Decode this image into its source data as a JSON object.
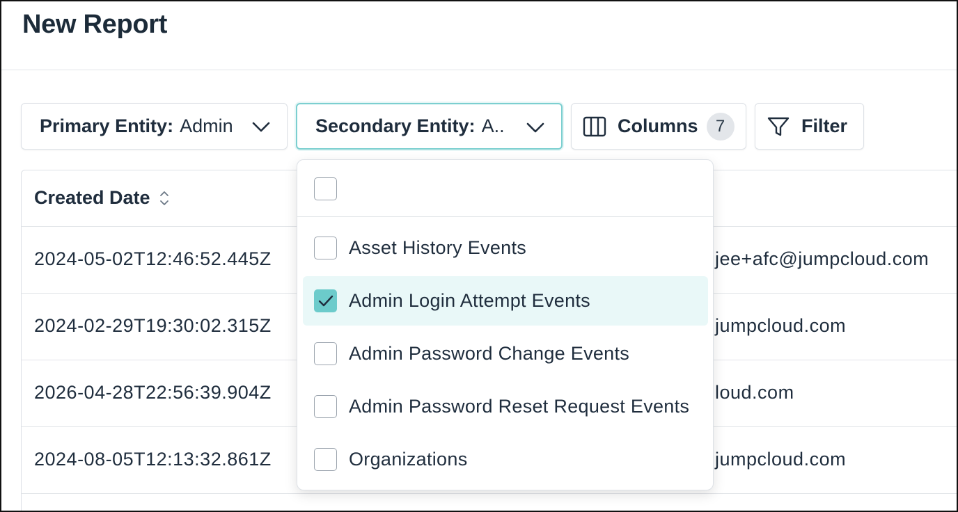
{
  "header": {
    "title": "New Report"
  },
  "toolbar": {
    "primary": {
      "label": "Primary Entity:",
      "value": "Admin"
    },
    "secondary": {
      "label": "Secondary Entity:",
      "value": "A.."
    },
    "columns": {
      "label": "Columns",
      "count": "7"
    },
    "filter": {
      "label": "Filter"
    }
  },
  "table": {
    "header": "Created Date",
    "rows": [
      {
        "date": "2024-05-02T12:46:52.445Z",
        "email": "jee+afc@jumpcloud.com"
      },
      {
        "date": "2024-02-29T19:30:02.315Z",
        "email": "jumpcloud.com"
      },
      {
        "date": "2026-04-28T22:56:39.904Z",
        "email": "loud.com"
      },
      {
        "date": "2024-08-05T12:13:32.861Z",
        "email": "jumpcloud.com"
      }
    ]
  },
  "dropdown": {
    "options": [
      {
        "label": "Asset History Events",
        "checked": false
      },
      {
        "label": "Admin Login Attempt Events",
        "checked": true
      },
      {
        "label": "Admin Password Change Events",
        "checked": false
      },
      {
        "label": "Admin Password Reset Request Events",
        "checked": false
      },
      {
        "label": "Organizations",
        "checked": false
      }
    ]
  },
  "icons": {
    "chevron": "chevron-down-icon",
    "columns": "columns-icon",
    "filter": "filter-icon",
    "sort": "sort-icon",
    "check": "check-icon"
  },
  "colors": {
    "accent": "#6ccbcb",
    "selected_bg": "#e9f8f8",
    "text": "#1f2d3d"
  }
}
